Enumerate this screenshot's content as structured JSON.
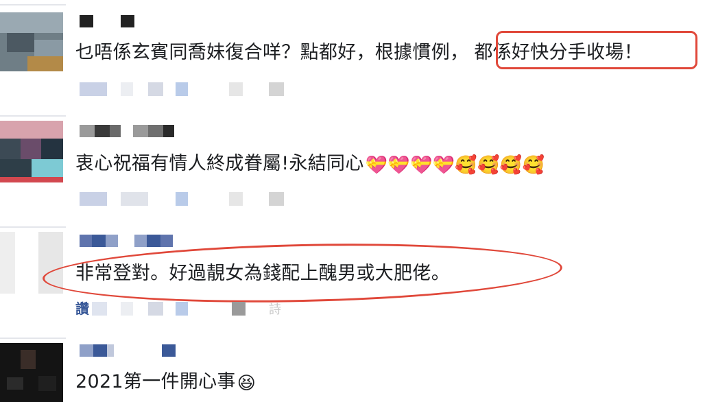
{
  "comments": [
    {
      "text_main": "乜唔係玄賓同喬妹復合咩？點都好，根據慣例，",
      "text_highlight": "都係好快分手收場！"
    },
    {
      "text_main": "衷心祝福有情人終成眷屬!永結同心",
      "emojis": [
        "💝",
        "💝",
        "💝",
        "💝",
        "🥰",
        "🥰",
        "🥰",
        "🥰"
      ]
    },
    {
      "text_main": "非常登對。好過靚女為錢配上醜男或大肥佬。",
      "like_label": "讚",
      "faint_char": "詩"
    },
    {
      "text_main": "2021第一件開心事",
      "emoji": "😆"
    }
  ],
  "colors": {
    "annotation_red": "#e0483a",
    "blur_blue": "#3b5998",
    "text": "#1c1e21"
  }
}
